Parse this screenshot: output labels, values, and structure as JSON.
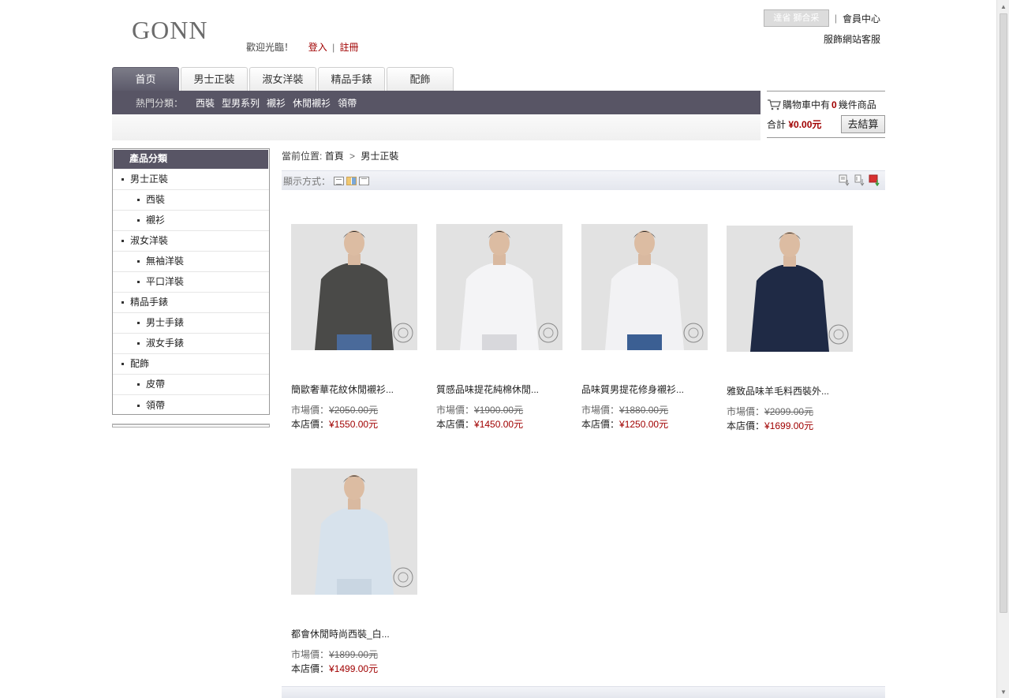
{
  "header": {
    "logo": "GONN",
    "welcome": "歡迎光臨！",
    "login": "登入",
    "sep": "|",
    "register": "註冊",
    "top_button": "達省 獅合采",
    "member_center": "會員中心",
    "service": "服飾網站客服"
  },
  "nav": {
    "tabs": [
      "首页",
      "男士正裝",
      "淑女洋裝",
      "精品手錶",
      "配飾"
    ],
    "hot_label": "熱門分類：",
    "hot_links": [
      "西裝",
      "型男系列",
      "襯衫",
      "休閒襯衫",
      "領帶"
    ]
  },
  "cart": {
    "text_before": "購物車中有",
    "count": "0",
    "text_after": "幾件商品",
    "total_label": "合計",
    "total_value": "¥0.00元",
    "checkout": "去結算"
  },
  "sidebar": {
    "title": "產品分類",
    "items": [
      {
        "label": "男士正裝",
        "level": 1
      },
      {
        "label": "西裝",
        "level": 2
      },
      {
        "label": "襯衫",
        "level": 2
      },
      {
        "label": "淑女洋裝",
        "level": 1
      },
      {
        "label": "無袖洋裝",
        "level": 2
      },
      {
        "label": "平口洋裝",
        "level": 2
      },
      {
        "label": "精品手錶",
        "level": 1
      },
      {
        "label": "男士手錶",
        "level": 2
      },
      {
        "label": "淑女手錶",
        "level": 2
      },
      {
        "label": "配飾",
        "level": 1
      },
      {
        "label": "皮帶",
        "level": 2
      },
      {
        "label": "領帶",
        "level": 2
      }
    ]
  },
  "breadcrumb": {
    "prefix": "當前位置:",
    "home": "首頁",
    "gt": ">",
    "current": "男士正裝"
  },
  "display": {
    "label": "顯示方式："
  },
  "products": [
    {
      "name": "簡歐奢華花紋休閒襯衫...",
      "market_label": "市場價：",
      "market_price": "¥2050.00元",
      "our_label": "本店價：",
      "our_price": "¥1550.00元",
      "shirt": "#4a4a48",
      "pants": "#4a6a9a"
    },
    {
      "name": "質感品味提花純棉休閒...",
      "market_label": "市場價：",
      "market_price": "¥1900.00元",
      "our_label": "本店價：",
      "our_price": "¥1450.00元",
      "shirt": "#f4f4f6",
      "pants": "#d8d8dc"
    },
    {
      "name": "品味質男提花修身襯衫...",
      "market_label": "市場價：",
      "market_price": "¥1880.00元",
      "our_label": "本店價：",
      "our_price": "¥1250.00元",
      "shirt": "#f2f2f4",
      "pants": "#3b5f93"
    },
    {
      "name": "雅致品味羊毛料西裝外...",
      "market_label": "市場價：",
      "market_price": "¥2099.00元",
      "our_label": "本店價：",
      "our_price": "¥1699.00元",
      "shirt": "#1f2a45",
      "pants": "#1f2a45"
    },
    {
      "name": "都會休閒時尚西裝_白...",
      "market_label": "市場價：",
      "market_price": "¥1899.00元",
      "our_label": "本店價：",
      "our_price": "¥1499.00元",
      "shirt": "#d7e2ec",
      "pants": "#c9d6e2"
    }
  ],
  "colors": {
    "nav_dark": "#585565",
    "price_red": "#a00000"
  }
}
